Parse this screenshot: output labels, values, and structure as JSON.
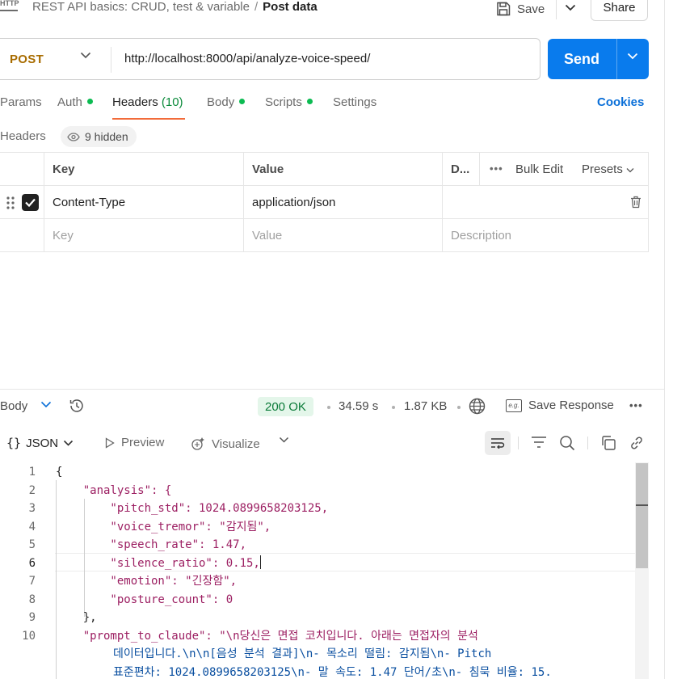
{
  "header": {
    "app_icon": "http-icon",
    "app_icon_text": "HTTP",
    "collection": "REST API basics: CRUD, test & variable",
    "separator": "/",
    "request_name": "Post data",
    "save_label": "Save",
    "share_label": "Share"
  },
  "request": {
    "method": "POST",
    "url": "http://localhost:8000/api/analyze-voice-speed/",
    "send_label": "Send"
  },
  "tabs": [
    {
      "label": "Params",
      "dot": false
    },
    {
      "label": "Auth",
      "dot": true
    },
    {
      "label": "Headers",
      "count": "(10)",
      "active": true
    },
    {
      "label": "Body",
      "dot": true
    },
    {
      "label": "Scripts",
      "dot": true
    },
    {
      "label": "Settings",
      "dot": false
    }
  ],
  "cookies_label": "Cookies",
  "headers_section": {
    "title": "Headers",
    "hidden_label": "9 hidden",
    "columns": {
      "key": "Key",
      "value": "Value",
      "description": "D...",
      "more": "•••",
      "bulk_edit": "Bulk Edit",
      "presets": "Presets"
    },
    "rows": [
      {
        "checked": true,
        "key": "Content-Type",
        "value": "application/json",
        "description": ""
      }
    ],
    "placeholders": {
      "key": "Key",
      "value": "Value",
      "description": "Description"
    }
  },
  "response_bar": {
    "body_label": "Body",
    "status": "200 OK",
    "time": "34.59 s",
    "size": "1.87 KB",
    "save_response": "Save Response",
    "more": "•••"
  },
  "format_bar": {
    "format_icon": "{}",
    "format": "JSON",
    "preview": "Preview",
    "visualize": "Visualize"
  },
  "code": {
    "current_line": 6,
    "lines": [
      {
        "n": "1",
        "text": "{"
      },
      {
        "n": "2",
        "text": "    \"analysis\": {"
      },
      {
        "n": "3",
        "text": "        \"pitch_std\": 1024.0899658203125,"
      },
      {
        "n": "4",
        "text": "        \"voice_tremor\": \"감지됨\","
      },
      {
        "n": "5",
        "text": "        \"speech_rate\": 1.47,"
      },
      {
        "n": "6",
        "text": "        \"silence_ratio\": 0.15,"
      },
      {
        "n": "7",
        "text": "        \"emotion\": \"긴장함\","
      },
      {
        "n": "8",
        "text": "        \"posture_count\": 0"
      },
      {
        "n": "9",
        "text": "    },"
      },
      {
        "n": "10",
        "text": "    \"prompt_to_claude\": \"\\n당신은 면접 코치입니다. 아래는 면접자의 분석"
      }
    ],
    "continuation": [
      "데이터입니다.\\n\\n[음성 분석 결과]\\n- 목소리 떨림: 감지됨\\n- Pitch",
      "표준편차: 1024.0899658203125\\n- 말 속도: 1.47 단어/초\\n- 침묵 비율: 15."
    ]
  }
}
